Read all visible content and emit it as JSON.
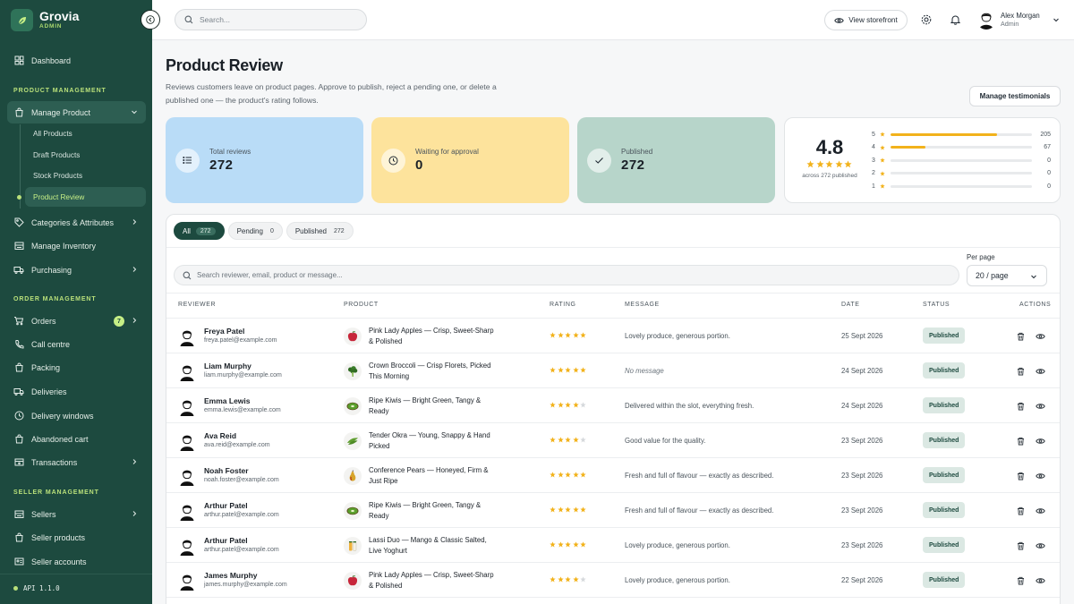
{
  "app": {
    "name": "Grovia",
    "subtitle": "ADMIN"
  },
  "colors": {
    "sidebar": "#1d4a3f",
    "accent": "#c6ef86",
    "star": "#f2b21b",
    "blue_card": "#b9dcf7",
    "yellow_card": "#fde39c",
    "green_card": "#b7d5ca"
  },
  "sidebar": {
    "dashboard": "Dashboard",
    "section_product": "PRODUCT MANAGEMENT",
    "manage_product": "Manage Product",
    "sub": [
      "All Products",
      "Draft Products",
      "Stock Products",
      "Product Review"
    ],
    "categories": "Categories & Attributes",
    "inventory": "Manage Inventory",
    "purchasing": "Purchasing",
    "section_order": "ORDER MANAGEMENT",
    "orders": "Orders",
    "orders_badge": "7",
    "call_centre": "Call centre",
    "packing": "Packing",
    "deliveries": "Deliveries",
    "delivery_windows": "Delivery windows",
    "abandoned_cart": "Abandoned cart",
    "transactions": "Transactions",
    "section_seller": "SELLER MANAGEMENT",
    "sellers": "Sellers",
    "seller_products": "Seller products",
    "seller_accounts": "Seller accounts",
    "api_version": "API 1.1.0"
  },
  "topbar": {
    "search_placeholder": "Search...",
    "view_storefront": "View storefront",
    "user_name": "Alex Morgan",
    "user_role": "Admin"
  },
  "page": {
    "title": "Product Review",
    "description": "Reviews customers leave on product pages. Approve to publish, reject a pending one, or delete a published one — the product's rating follows.",
    "manage_testimonials": "Manage testimonials"
  },
  "stats": {
    "total_label": "Total reviews",
    "total_value": "272",
    "waiting_label": "Waiting for approval",
    "waiting_value": "0",
    "published_label": "Published",
    "published_value": "272"
  },
  "rating_summary": {
    "average": "4.8",
    "average_stars": 5,
    "across": "across 272 published",
    "distribution": [
      {
        "star": "5",
        "count": "205",
        "fraction": 0.754
      },
      {
        "star": "4",
        "count": "67",
        "fraction": 0.246
      },
      {
        "star": "3",
        "count": "0",
        "fraction": 0
      },
      {
        "star": "2",
        "count": "0",
        "fraction": 0
      },
      {
        "star": "1",
        "count": "0",
        "fraction": 0
      }
    ]
  },
  "tabs": [
    {
      "label": "All",
      "count": "272"
    },
    {
      "label": "Pending",
      "count": "0"
    },
    {
      "label": "Published",
      "count": "272"
    }
  ],
  "table": {
    "search_placeholder": "Search reviewer, email, product or message...",
    "per_page_label": "Per page",
    "per_page_value": "20 / page",
    "headers": {
      "reviewer": "REVIEWER",
      "product": "PRODUCT",
      "rating": "RATING",
      "message": "MESSAGE",
      "date": "DATE",
      "status": "STATUS",
      "actions": "ACTIONS"
    },
    "rows": [
      {
        "name": "Freya Patel",
        "email": "freya.patel@example.com",
        "product": "Pink Lady Apples — Crisp, Sweet-Sharp & Polished",
        "product_icon": "apple-icon",
        "rating": 5,
        "message": "Lovely produce, generous portion.",
        "date": "25 Sept 2026",
        "status": "Published"
      },
      {
        "name": "Liam Murphy",
        "email": "liam.murphy@example.com",
        "product": "Crown Broccoli — Crisp Florets, Picked This Morning",
        "product_icon": "broccoli-icon",
        "rating": 5,
        "message": "No message",
        "date": "24 Sept 2026",
        "status": "Published"
      },
      {
        "name": "Emma Lewis",
        "email": "emma.lewis@example.com",
        "product": "Ripe Kiwis — Bright Green, Tangy & Ready",
        "product_icon": "kiwi-icon",
        "rating": 4,
        "message": "Delivered within the slot, everything fresh.",
        "date": "24 Sept 2026",
        "status": "Published"
      },
      {
        "name": "Ava Reid",
        "email": "ava.reid@example.com",
        "product": "Tender Okra — Young, Snappy & Hand Picked",
        "product_icon": "okra-icon",
        "rating": 4,
        "message": "Good value for the quality.",
        "date": "23 Sept 2026",
        "status": "Published"
      },
      {
        "name": "Noah Foster",
        "email": "noah.foster@example.com",
        "product": "Conference Pears — Honeyed, Firm & Just Ripe",
        "product_icon": "pear-icon",
        "rating": 5,
        "message": "Fresh and full of flavour — exactly as described.",
        "date": "23 Sept 2026",
        "status": "Published"
      },
      {
        "name": "Arthur Patel",
        "email": "arthur.patel@example.com",
        "product": "Ripe Kiwis — Bright Green, Tangy & Ready",
        "product_icon": "kiwi-icon",
        "rating": 5,
        "message": "Fresh and full of flavour — exactly as described.",
        "date": "23 Sept 2026",
        "status": "Published"
      },
      {
        "name": "Arthur Patel",
        "email": "arthur.patel@example.com",
        "product": "Lassi Duo — Mango & Classic Salted, Live Yoghurt",
        "product_icon": "lassi-icon",
        "rating": 5,
        "message": "Lovely produce, generous portion.",
        "date": "23 Sept 2026",
        "status": "Published"
      },
      {
        "name": "James Murphy",
        "email": "james.murphy@example.com",
        "product": "Pink Lady Apples — Crisp, Sweet-Sharp & Polished",
        "product_icon": "apple-icon",
        "rating": 4,
        "message": "Lovely produce, generous portion.",
        "date": "22 Sept 2026",
        "status": "Published"
      }
    ]
  }
}
